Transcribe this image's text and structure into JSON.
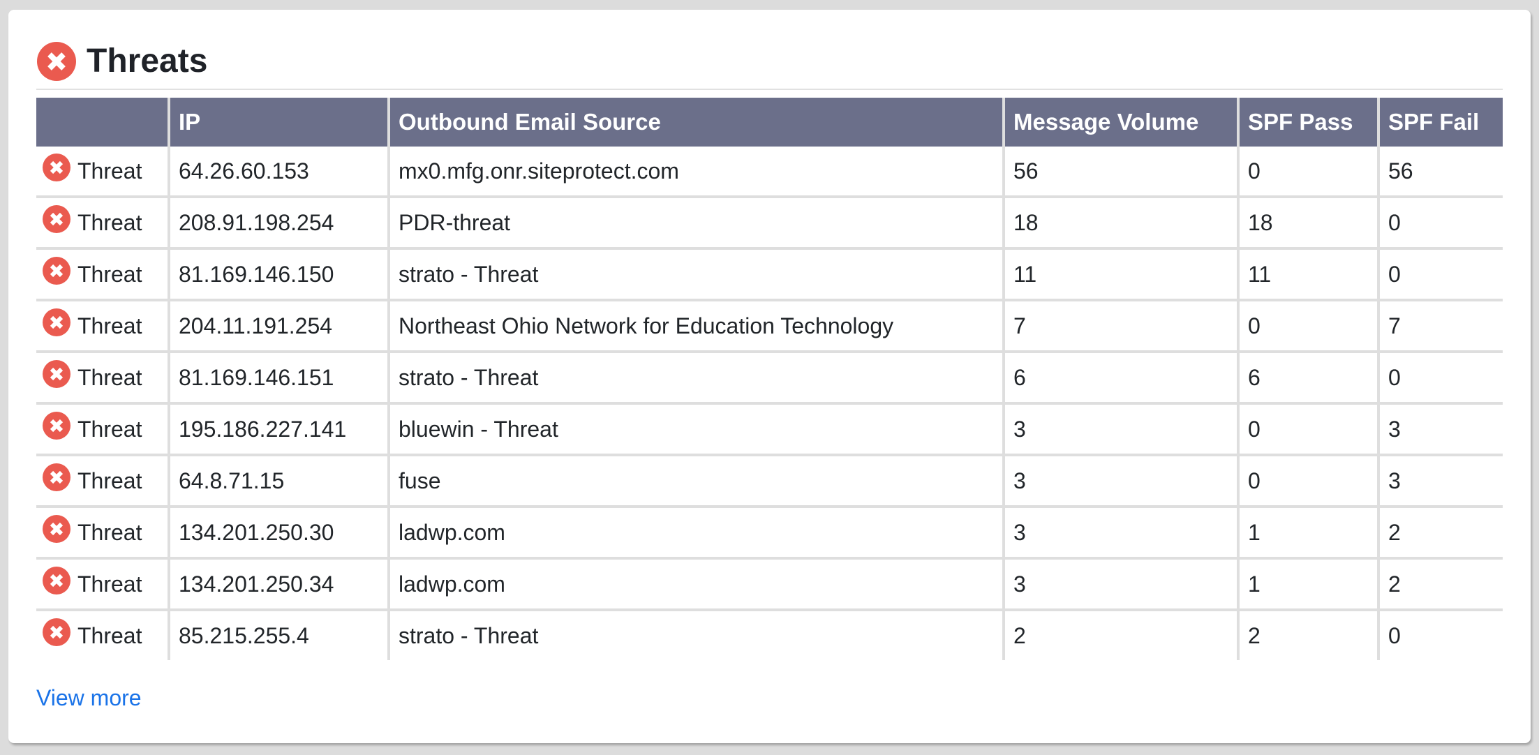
{
  "card": {
    "title": "Threats",
    "title_icon": "x-circle-icon",
    "accent_color": "#ea5a4f",
    "header_color": "#6b6f8a"
  },
  "table": {
    "columns": [
      "",
      "IP",
      "Outbound Email Source",
      "Message Volume",
      "SPF Pass",
      "SPF Fail"
    ],
    "rows": [
      {
        "status": "Threat",
        "status_icon": "x-circle-icon",
        "ip": "64.26.60.153",
        "source": "mx0.mfg.onr.siteprotect.com",
        "volume": "56",
        "spf_pass": "0",
        "spf_fail": "56"
      },
      {
        "status": "Threat",
        "status_icon": "x-circle-icon",
        "ip": "208.91.198.254",
        "source": "PDR-threat",
        "volume": "18",
        "spf_pass": "18",
        "spf_fail": "0"
      },
      {
        "status": "Threat",
        "status_icon": "x-circle-icon",
        "ip": "81.169.146.150",
        "source": "strato - Threat",
        "volume": "11",
        "spf_pass": "11",
        "spf_fail": "0"
      },
      {
        "status": "Threat",
        "status_icon": "x-circle-icon",
        "ip": "204.11.191.254",
        "source": "Northeast Ohio Network for Education Technology",
        "volume": "7",
        "spf_pass": "0",
        "spf_fail": "7"
      },
      {
        "status": "Threat",
        "status_icon": "x-circle-icon",
        "ip": "81.169.146.151",
        "source": "strato - Threat",
        "volume": "6",
        "spf_pass": "6",
        "spf_fail": "0"
      },
      {
        "status": "Threat",
        "status_icon": "x-circle-icon",
        "ip": "195.186.227.141",
        "source": "bluewin - Threat",
        "volume": "3",
        "spf_pass": "0",
        "spf_fail": "3"
      },
      {
        "status": "Threat",
        "status_icon": "x-circle-icon",
        "ip": "64.8.71.15",
        "source": "fuse",
        "volume": "3",
        "spf_pass": "0",
        "spf_fail": "3"
      },
      {
        "status": "Threat",
        "status_icon": "x-circle-icon",
        "ip": "134.201.250.30",
        "source": "ladwp.com",
        "volume": "3",
        "spf_pass": "1",
        "spf_fail": "2"
      },
      {
        "status": "Threat",
        "status_icon": "x-circle-icon",
        "ip": "134.201.250.34",
        "source": "ladwp.com",
        "volume": "3",
        "spf_pass": "1",
        "spf_fail": "2"
      },
      {
        "status": "Threat",
        "status_icon": "x-circle-icon",
        "ip": "85.215.255.4",
        "source": "strato - Threat",
        "volume": "2",
        "spf_pass": "2",
        "spf_fail": "0"
      }
    ]
  },
  "footer": {
    "view_more_label": "View more",
    "link_color": "#1a73e8"
  }
}
